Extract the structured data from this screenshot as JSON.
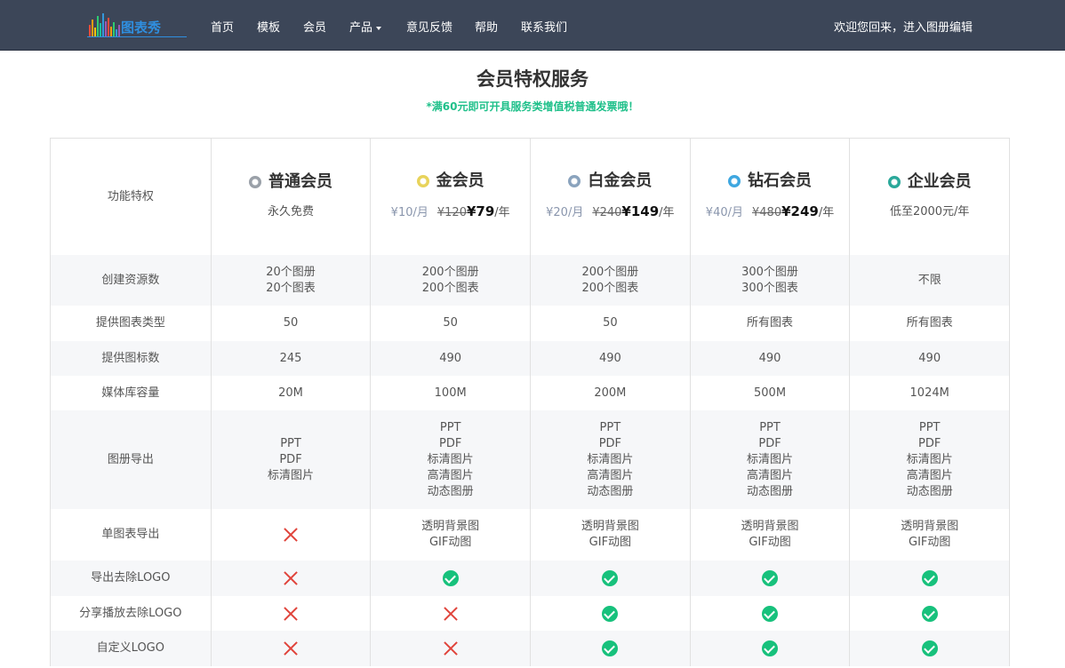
{
  "nav": {
    "logo_text": "图表秀",
    "items": [
      "首页",
      "模板",
      "会员",
      "产品",
      "意见反馈",
      "帮助",
      "联系我们"
    ],
    "welcome": "欢迎您回来，进入图册编辑"
  },
  "page": {
    "title": "会员特权服务",
    "subtitle": "*满60元即可开具服务类增值税普通发票哦！"
  },
  "plans": {
    "feature_header": "功能特权",
    "columns": [
      {
        "name": "普通会员",
        "gem_color": "#9aa0a8",
        "price_text": "永久免费"
      },
      {
        "name": "金会员",
        "gem_color": "#e8d35a",
        "month": "¥10/月",
        "old": "¥120",
        "new": "¥79",
        "unit": "/年"
      },
      {
        "name": "白金会员",
        "gem_color": "#8aa3bd",
        "month": "¥20/月",
        "old": "¥240",
        "new": "¥149",
        "unit": "/年"
      },
      {
        "name": "钻石会员",
        "gem_color": "#3ea7e0",
        "month": "¥40/月",
        "old": "¥480",
        "new": "¥249",
        "unit": "/年"
      },
      {
        "name": "企业会员",
        "gem_color": "#2aa89a",
        "price_text": "低至2000元/年"
      }
    ]
  },
  "rows": [
    {
      "feature": "创建资源数",
      "values": [
        [
          "20个图册",
          "20个图表"
        ],
        [
          "200个图册",
          "200个图表"
        ],
        [
          "200个图册",
          "200个图表"
        ],
        [
          "300个图册",
          "300个图表"
        ],
        [
          "不限"
        ]
      ]
    },
    {
      "feature": "提供图表类型",
      "values": [
        [
          "50"
        ],
        [
          "50"
        ],
        [
          "50"
        ],
        [
          "所有图表"
        ],
        [
          "所有图表"
        ]
      ]
    },
    {
      "feature": "提供图标数",
      "values": [
        [
          "245"
        ],
        [
          "490"
        ],
        [
          "490"
        ],
        [
          "490"
        ],
        [
          "490"
        ]
      ]
    },
    {
      "feature": "媒体库容量",
      "values": [
        [
          "20M"
        ],
        [
          "100M"
        ],
        [
          "200M"
        ],
        [
          "500M"
        ],
        [
          "1024M"
        ]
      ]
    },
    {
      "feature": "图册导出",
      "values": [
        [
          "PPT",
          "PDF",
          "标清图片"
        ],
        [
          "PPT",
          "PDF",
          "标清图片",
          "高清图片",
          "动态图册"
        ],
        [
          "PPT",
          "PDF",
          "标清图片",
          "高清图片",
          "动态图册"
        ],
        [
          "PPT",
          "PDF",
          "标清图片",
          "高清图片",
          "动态图册"
        ],
        [
          "PPT",
          "PDF",
          "标清图片",
          "高清图片",
          "动态图册"
        ]
      ]
    },
    {
      "feature": "单图表导出",
      "values": [
        "cross",
        [
          "透明背景图",
          "GIF动图"
        ],
        [
          "透明背景图",
          "GIF动图"
        ],
        [
          "透明背景图",
          "GIF动图"
        ],
        [
          "透明背景图",
          "GIF动图"
        ]
      ]
    },
    {
      "feature": "导出去除LOGO",
      "values": [
        "cross",
        "check",
        "check",
        "check",
        "check"
      ]
    },
    {
      "feature": "分享播放去除LOGO",
      "values": [
        "cross",
        "cross",
        "check",
        "check",
        "check"
      ]
    },
    {
      "feature": "自定义LOGO",
      "values": [
        "cross",
        "cross",
        "check",
        "check",
        "check"
      ]
    }
  ],
  "icons": {
    "gem": "gem-icon",
    "cross": "cross-icon",
    "check": "check-circle-icon"
  },
  "colors": {
    "nav_bg": "#3c4658",
    "accent_green": "#1fc08a",
    "cross_red": "#e0433a",
    "check_green": "#17c17c",
    "alt_row": "#f6f7f9"
  }
}
